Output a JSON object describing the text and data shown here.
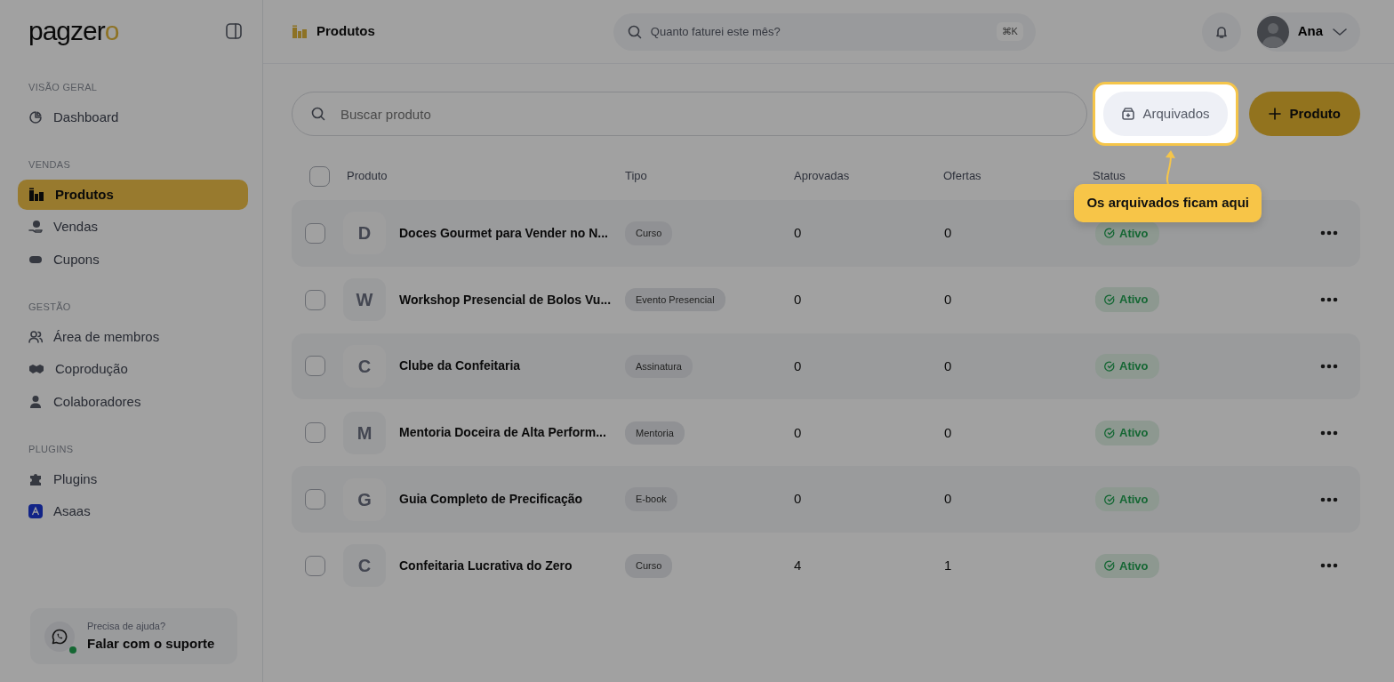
{
  "logo": {
    "wordmark": "pagzer",
    "accent": "o"
  },
  "sidebar": {
    "sections": [
      {
        "label": "VISÃO GERAL",
        "items": [
          {
            "label": "Dashboard",
            "selected": false
          }
        ]
      },
      {
        "label": "VENDAS",
        "items": [
          {
            "label": "Produtos",
            "selected": true
          },
          {
            "label": "Vendas",
            "selected": false
          },
          {
            "label": "Cupons",
            "selected": false
          }
        ]
      },
      {
        "label": "GESTÃO",
        "items": [
          {
            "label": "Área de membros",
            "selected": false
          },
          {
            "label": "Coprodução",
            "selected": false
          },
          {
            "label": "Colaboradores",
            "selected": false
          }
        ]
      },
      {
        "label": "PLUGINS",
        "items": [
          {
            "label": "Plugins",
            "selected": false
          },
          {
            "label": "Asaas",
            "selected": false
          }
        ]
      }
    ],
    "help": {
      "caption": "Precisa de ajuda?",
      "title": "Falar com o suporte",
      "online": true
    }
  },
  "header": {
    "title": "Produtos",
    "search": {
      "placeholder": "Quanto faturei este mês?",
      "shortcut": "⌘K"
    },
    "user": {
      "name": "Ana"
    }
  },
  "toolbar": {
    "search": {
      "placeholder": "Buscar produto"
    },
    "archived_button": "Arquivados",
    "new_button": "Produto",
    "tooltip": "Os arquivados ficam aqui"
  },
  "table": {
    "all_selected": false,
    "columns": [
      "Produto",
      "Tipo",
      "Aprovadas",
      "Ofertas",
      "Status"
    ],
    "rows": [
      {
        "initial": "D",
        "name": "Doces Gourmet para Vender no N...",
        "type": "Curso",
        "approved": "0",
        "offers": "0",
        "status": "Ativo",
        "selected": false
      },
      {
        "initial": "W",
        "name": "Workshop Presencial de Bolos Vu...",
        "type": "Evento Presencial",
        "approved": "0",
        "offers": "0",
        "status": "Ativo",
        "selected": false
      },
      {
        "initial": "C",
        "name": "Clube da Confeitaria",
        "type": "Assinatura",
        "approved": "0",
        "offers": "0",
        "status": "Ativo",
        "selected": false
      },
      {
        "initial": "M",
        "name": "Mentoria Doceira de Alta Perform...",
        "type": "Mentoria",
        "approved": "0",
        "offers": "0",
        "status": "Ativo",
        "selected": false
      },
      {
        "initial": "G",
        "name": "Guia Completo de Precificação",
        "type": "E-book",
        "approved": "0",
        "offers": "0",
        "status": "Ativo",
        "selected": false
      },
      {
        "initial": "C",
        "name": "Confeitaria Lucrativa do Zero",
        "type": "Curso",
        "approved": "4",
        "offers": "1",
        "status": "Ativo",
        "selected": false
      }
    ]
  }
}
